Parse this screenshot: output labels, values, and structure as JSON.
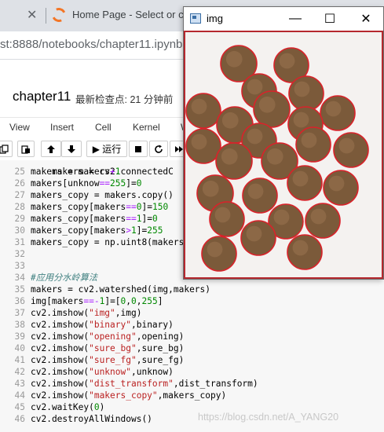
{
  "browser": {
    "tab_close_glyph": "✕",
    "tab_title": "Home Page - Select or c",
    "url": "st:8888/notebooks/chapter11.ipynb"
  },
  "notebook": {
    "title": "chapter11",
    "checkpoint": "最新检查点: 21 分钟前",
    "menu": [
      "View",
      "Insert",
      "Cell",
      "Kernel",
      "W"
    ],
    "toolbar": {
      "run_label": "▶ 运行"
    }
  },
  "code": {
    "partial_top_line": "    makers = cv2.connectedC",
    "lines": [
      {
        "num": "25",
        "tokens": [
          [
            "makers = makers",
            "v"
          ],
          [
            "+",
            "o"
          ],
          [
            "1",
            "n"
          ]
        ]
      },
      {
        "num": "26",
        "tokens": [
          [
            "makers[unknow",
            "v"
          ],
          [
            "==",
            "o"
          ],
          [
            "255",
            "n"
          ],
          [
            "]=",
            "v"
          ],
          [
            "0",
            "n"
          ]
        ]
      },
      {
        "num": "27",
        "tokens": [
          [
            "makers_copy = makers.copy()",
            "v"
          ]
        ]
      },
      {
        "num": "28",
        "tokens": [
          [
            "makers_copy[makers",
            "v"
          ],
          [
            "==",
            "o"
          ],
          [
            "0",
            "n"
          ],
          [
            "]=",
            "v"
          ],
          [
            "150",
            "n"
          ]
        ]
      },
      {
        "num": "29",
        "tokens": [
          [
            "makers_copy[makers",
            "v"
          ],
          [
            "==",
            "o"
          ],
          [
            "1",
            "n"
          ],
          [
            "]=",
            "v"
          ],
          [
            "0",
            "n"
          ]
        ]
      },
      {
        "num": "30",
        "tokens": [
          [
            "makers_copy[makers",
            "v"
          ],
          [
            ">",
            "o"
          ],
          [
            "1",
            "n"
          ],
          [
            "]=",
            "v"
          ],
          [
            "255",
            "n"
          ]
        ]
      },
      {
        "num": "31",
        "tokens": [
          [
            "makers_copy = np.uint8(makers_copy)",
            "v"
          ]
        ]
      },
      {
        "num": "32",
        "tokens": []
      },
      {
        "num": "33",
        "tokens": []
      },
      {
        "num": "34",
        "tokens": [
          [
            "#应用分水岭算法",
            "c"
          ]
        ]
      },
      {
        "num": "35",
        "tokens": [
          [
            "makers = cv2.watershed(img,makers)",
            "v"
          ]
        ]
      },
      {
        "num": "36",
        "tokens": [
          [
            "img[makers",
            "v"
          ],
          [
            "==-",
            "o"
          ],
          [
            "1",
            "n"
          ],
          [
            "]=[",
            "v"
          ],
          [
            "0",
            "n"
          ],
          [
            ",",
            "v"
          ],
          [
            "0",
            "n"
          ],
          [
            ",",
            "v"
          ],
          [
            "255",
            "n"
          ],
          [
            "]",
            "v"
          ]
        ]
      },
      {
        "num": "37",
        "tokens": [
          [
            "cv2.imshow(",
            "v"
          ],
          [
            "\"img\"",
            "s"
          ],
          [
            ",img)",
            "v"
          ]
        ]
      },
      {
        "num": "38",
        "tokens": [
          [
            "cv2.imshow(",
            "v"
          ],
          [
            "\"binary\"",
            "s"
          ],
          [
            ",binary)",
            "v"
          ]
        ]
      },
      {
        "num": "39",
        "tokens": [
          [
            "cv2.imshow(",
            "v"
          ],
          [
            "\"opening\"",
            "s"
          ],
          [
            ",opening)",
            "v"
          ]
        ]
      },
      {
        "num": "40",
        "tokens": [
          [
            "cv2.imshow(",
            "v"
          ],
          [
            "\"sure_bg\"",
            "s"
          ],
          [
            ",sure_bg)",
            "v"
          ]
        ]
      },
      {
        "num": "41",
        "tokens": [
          [
            "cv2.imshow(",
            "v"
          ],
          [
            "\"sure_fg\"",
            "s"
          ],
          [
            ",sure_fg)",
            "v"
          ]
        ]
      },
      {
        "num": "42",
        "tokens": [
          [
            "cv2.imshow(",
            "v"
          ],
          [
            "\"unknow\"",
            "s"
          ],
          [
            ",unknow)",
            "v"
          ]
        ]
      },
      {
        "num": "43",
        "tokens": [
          [
            "cv2.imshow(",
            "v"
          ],
          [
            "\"dist_transform\"",
            "s"
          ],
          [
            ",dist_transform)",
            "v"
          ]
        ]
      },
      {
        "num": "44",
        "tokens": [
          [
            "cv2.imshow(",
            "v"
          ],
          [
            "\"makers_copy\"",
            "s"
          ],
          [
            ",makers_copy)",
            "v"
          ]
        ]
      },
      {
        "num": "45",
        "tokens": [
          [
            "cv2.waitKey(",
            "v"
          ],
          [
            "0",
            "n"
          ],
          [
            ")",
            "v"
          ]
        ]
      },
      {
        "num": "46",
        "tokens": [
          [
            "cv2.destroyAllWindows()",
            "v"
          ]
        ]
      }
    ]
  },
  "watermark": "https://blog.csdn.net/A_YANG20",
  "image_window": {
    "title": "img",
    "minimize_glyph": "—",
    "maximize_glyph": "☐",
    "close_glyph": "✕",
    "icon": "image-window-icon",
    "colors": {
      "border": "#b5282e",
      "coin": "#7b5a3a",
      "coin_edge": "#d8232a",
      "background": "#f4f2f0"
    }
  },
  "icons": [
    "tab-close-icon",
    "jupyter-logo-icon",
    "save-icon",
    "copy-icon",
    "arrow-up-icon",
    "arrow-down-icon",
    "play-icon",
    "stop-icon",
    "restart-icon",
    "fast-forward-icon"
  ]
}
